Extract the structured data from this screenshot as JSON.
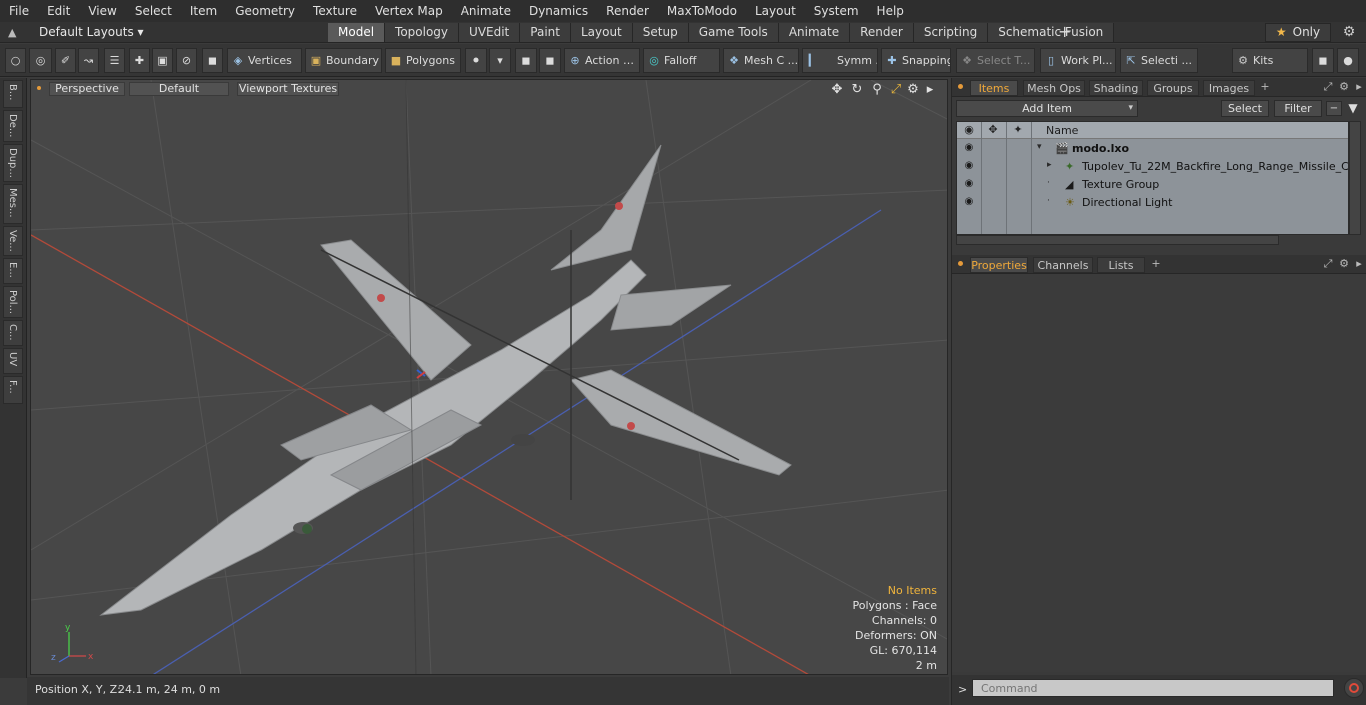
{
  "menubar": [
    "File",
    "Edit",
    "View",
    "Select",
    "Item",
    "Geometry",
    "Texture",
    "Vertex Map",
    "Animate",
    "Dynamics",
    "Render",
    "MaxToModo",
    "Layout",
    "System",
    "Help"
  ],
  "layout": {
    "selector": "Default Layouts ▾"
  },
  "tabs": [
    "Model",
    "Topology",
    "UVEdit",
    "Paint",
    "Layout",
    "Setup",
    "Game Tools",
    "Animate",
    "Render",
    "Scripting",
    "Schematic Fusion"
  ],
  "active_tab": "Model",
  "only_label": "Only",
  "toolbar": {
    "vertices": "Vertices",
    "boundary": "Boundary",
    "polygons": "Polygons",
    "action": "Action",
    "falloff": "Falloff",
    "mesh": "Mesh C ...",
    "symm": "Symm ...",
    "snapping": "Snapping",
    "select_t": "Select T...",
    "workpl": "Work Pl...",
    "selecti": "Selecti ...",
    "kits": "Kits"
  },
  "left_tabs": [
    "B...",
    "De...",
    "Dup...",
    "Mes...",
    "Ve...",
    "E...",
    "Pol...",
    "C...",
    "UV",
    "F..."
  ],
  "viewport": {
    "view_mode": "Perspective",
    "shading": "Default",
    "textures": "Viewport Textures",
    "info": {
      "no_items": "No Items",
      "polygons": "Polygons : Face",
      "channels": "Channels: 0",
      "deformers": "Deformers: ON",
      "gl": "GL: 670,114",
      "scale": "2 m"
    }
  },
  "status": {
    "position_label": "Position X, Y, Z:",
    "position_value": "24.1 m, 24 m, 0 m"
  },
  "items_panel": {
    "tabs": [
      "Items",
      "Mesh Ops",
      "Shading",
      "Groups",
      "Images"
    ],
    "add_item": "Add Item",
    "select": "Select",
    "filter": "Filter",
    "name_header": "Name",
    "rows": [
      {
        "label": "modo.lxo"
      },
      {
        "label": "Tupolev_Tu_22M_Backfire_Long_Range_Missile_Car ..."
      },
      {
        "label": "Texture Group"
      },
      {
        "label": "Directional Light"
      }
    ]
  },
  "props_panel": {
    "tabs": [
      "Properties",
      "Channels",
      "Lists"
    ]
  },
  "command": {
    "placeholder": "Command"
  },
  "colors": {
    "accent": "#f0a93a",
    "viewport_bg": "#474747",
    "tree_bg": "#8d9399",
    "record": "#e04a3a"
  }
}
